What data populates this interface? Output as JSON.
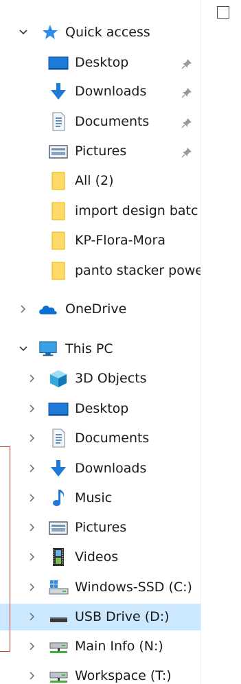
{
  "quick_access": {
    "label": "Quick access",
    "items": [
      {
        "label": "Desktop",
        "icon": "desktop-icon",
        "pinned": true
      },
      {
        "label": "Downloads",
        "icon": "downloads-icon",
        "pinned": true
      },
      {
        "label": "Documents",
        "icon": "documents-icon",
        "pinned": true
      },
      {
        "label": "Pictures",
        "icon": "pictures-icon",
        "pinned": true
      },
      {
        "label": "All (2)",
        "icon": "folder-icon",
        "pinned": false
      },
      {
        "label": "import design batc",
        "icon": "folder-icon",
        "pinned": false
      },
      {
        "label": "KP-Flora-Mora",
        "icon": "folder-icon",
        "pinned": false
      },
      {
        "label": "panto stacker powe",
        "icon": "folder-icon",
        "pinned": false
      }
    ]
  },
  "onedrive": {
    "label": "OneDrive"
  },
  "this_pc": {
    "label": "This PC",
    "items": [
      {
        "label": "3D Objects",
        "icon": "3d-objects-icon"
      },
      {
        "label": "Desktop",
        "icon": "desktop-icon"
      },
      {
        "label": "Documents",
        "icon": "documents-icon"
      },
      {
        "label": "Downloads",
        "icon": "downloads-icon"
      },
      {
        "label": "Music",
        "icon": "music-icon"
      },
      {
        "label": "Pictures",
        "icon": "pictures-icon"
      },
      {
        "label": "Videos",
        "icon": "videos-icon"
      },
      {
        "label": "Windows-SSD (C:)",
        "icon": "windows-drive-icon"
      },
      {
        "label": "USB Drive (D:)",
        "icon": "usb-drive-icon",
        "selected": true
      },
      {
        "label": "Main Info (N:)",
        "icon": "network-drive-icon"
      },
      {
        "label": "Workspace (T:)",
        "icon": "network-drive-icon"
      }
    ]
  },
  "colors": {
    "selection": "#cce8ff",
    "folder": "#ffd86a",
    "accent_blue": "#1e7ad9",
    "frame": "#c0392b"
  }
}
